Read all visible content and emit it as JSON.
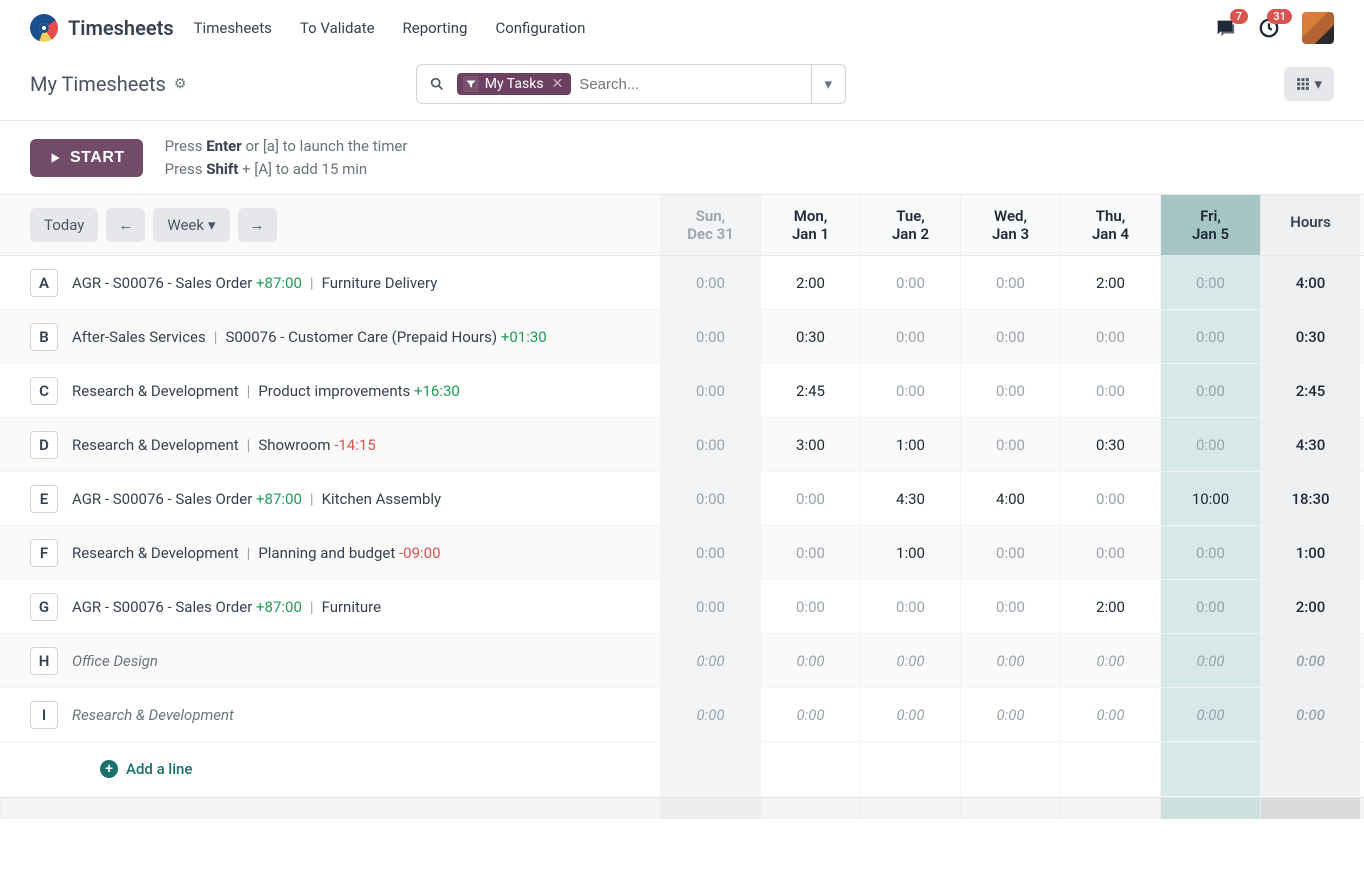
{
  "nav": {
    "app_title": "Timesheets",
    "items": [
      "Timesheets",
      "To Validate",
      "Reporting",
      "Configuration"
    ],
    "msg_badge": "7",
    "activity_badge": "31"
  },
  "control": {
    "page_title": "My Timesheets",
    "filter_label": "My Tasks",
    "search_placeholder": "Search..."
  },
  "start": {
    "button": "START",
    "hint1_pre": "Press ",
    "hint1_key": "Enter",
    "hint1_post": " or [a] to launch the timer",
    "hint2_pre": "Press ",
    "hint2_key": "Shift",
    "hint2_post": " + [A] to add 15 min"
  },
  "grid": {
    "today_label": "Today",
    "period_label": "Week",
    "days": [
      {
        "dow": "Sun,",
        "date": "Dec 31",
        "muted": true
      },
      {
        "dow": "Mon,",
        "date": "Jan 1"
      },
      {
        "dow": "Tue,",
        "date": "Jan 2"
      },
      {
        "dow": "Wed,",
        "date": "Jan 3"
      },
      {
        "dow": "Thu,",
        "date": "Jan 4"
      },
      {
        "dow": "Fri,",
        "date": "Jan 5",
        "today": true
      }
    ],
    "hours_label": "Hours",
    "rows": [
      {
        "key": "A",
        "project": "AGR - S00076 - Sales Order",
        "over": "+87:00",
        "over_class": "green",
        "task": "Furniture Delivery",
        "cells": [
          "0:00",
          "2:00",
          "0:00",
          "0:00",
          "2:00",
          "0:00"
        ],
        "filled": [
          false,
          true,
          false,
          false,
          true,
          false
        ],
        "total": "4:00"
      },
      {
        "key": "B",
        "project": "After-Sales Services",
        "task": "S00076 - Customer Care (Prepaid Hours)",
        "over": "+01:30",
        "over_after_task": true,
        "over_class": "green",
        "cells": [
          "0:00",
          "0:30",
          "0:00",
          "0:00",
          "0:00",
          "0:00"
        ],
        "filled": [
          false,
          true,
          false,
          false,
          false,
          false
        ],
        "total": "0:30"
      },
      {
        "key": "C",
        "project": "Research & Development",
        "task": "Product improvements",
        "over": "+16:30",
        "over_after_task": true,
        "over_class": "green",
        "cells": [
          "0:00",
          "2:45",
          "0:00",
          "0:00",
          "0:00",
          "0:00"
        ],
        "filled": [
          false,
          true,
          false,
          false,
          false,
          false
        ],
        "total": "2:45"
      },
      {
        "key": "D",
        "project": "Research & Development",
        "task": "Showroom",
        "over": "-14:15",
        "over_after_task": true,
        "over_class": "red",
        "cells": [
          "0:00",
          "3:00",
          "1:00",
          "0:00",
          "0:30",
          "0:00"
        ],
        "filled": [
          false,
          true,
          true,
          false,
          true,
          false
        ],
        "total": "4:30"
      },
      {
        "key": "E",
        "project": "AGR - S00076 - Sales Order",
        "over": "+87:00",
        "over_class": "green",
        "task": "Kitchen Assembly",
        "cells": [
          "0:00",
          "0:00",
          "4:30",
          "4:00",
          "0:00",
          "10:00"
        ],
        "filled": [
          false,
          false,
          true,
          true,
          false,
          true
        ],
        "total": "18:30"
      },
      {
        "key": "F",
        "project": "Research & Development",
        "task": "Planning and budget",
        "over": "-09:00",
        "over_after_task": true,
        "over_class": "red",
        "cells": [
          "0:00",
          "0:00",
          "1:00",
          "0:00",
          "0:00",
          "0:00"
        ],
        "filled": [
          false,
          false,
          true,
          false,
          false,
          false
        ],
        "total": "1:00"
      },
      {
        "key": "G",
        "project": "AGR - S00076 - Sales Order",
        "over": "+87:00",
        "over_class": "green",
        "task": "Furniture",
        "cells": [
          "0:00",
          "0:00",
          "0:00",
          "0:00",
          "2:00",
          "0:00"
        ],
        "filled": [
          false,
          false,
          false,
          false,
          true,
          false
        ],
        "total": "2:00"
      },
      {
        "key": "H",
        "project": "Office Design",
        "italic": true,
        "cells": [
          "0:00",
          "0:00",
          "0:00",
          "0:00",
          "0:00",
          "0:00"
        ],
        "filled": [
          false,
          false,
          false,
          false,
          false,
          false
        ],
        "total": "0:00",
        "total_muted": true
      },
      {
        "key": "I",
        "project": "Research & Development",
        "italic": true,
        "cells": [
          "0:00",
          "0:00",
          "0:00",
          "0:00",
          "0:00",
          "0:00"
        ],
        "filled": [
          false,
          false,
          false,
          false,
          false,
          false
        ],
        "total": "0:00",
        "total_muted": true
      }
    ],
    "add_line": "Add a line"
  }
}
